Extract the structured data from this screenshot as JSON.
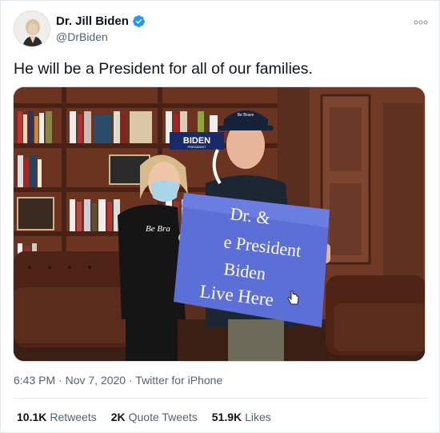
{
  "author": {
    "display_name": "Dr. Jill Biden",
    "handle": "@DrBiden",
    "verified_icon": "verified-badge-icon",
    "avatar_icon": "avatar"
  },
  "tweet": {
    "text": "He will be a President for all of our families."
  },
  "media": {
    "sign_lines": [
      "Dr. &",
      "e President",
      "Biden",
      "Live Here"
    ],
    "shirt_text": "Be Bra",
    "bookshelf_sign": "BIDEN",
    "bookshelf_sign_sub": "PRESIDENT",
    "cap_text": "Be Brave"
  },
  "meta": {
    "time": "6:43 PM",
    "date": "Nov 7, 2020",
    "source": "Twitter for iPhone",
    "separator": "·"
  },
  "stats": {
    "retweets_value": "10.1K",
    "retweets_label": "Retweets",
    "quotes_value": "2K",
    "quotes_label": "Quote Tweets",
    "likes_value": "51.9K",
    "likes_label": "Likes"
  },
  "colors": {
    "brand_blue": "#1d9bf0",
    "text_primary": "#0f1419",
    "text_secondary": "#536471",
    "divider": "#e6ecf0",
    "sign_blue": "#5b6fd6"
  }
}
